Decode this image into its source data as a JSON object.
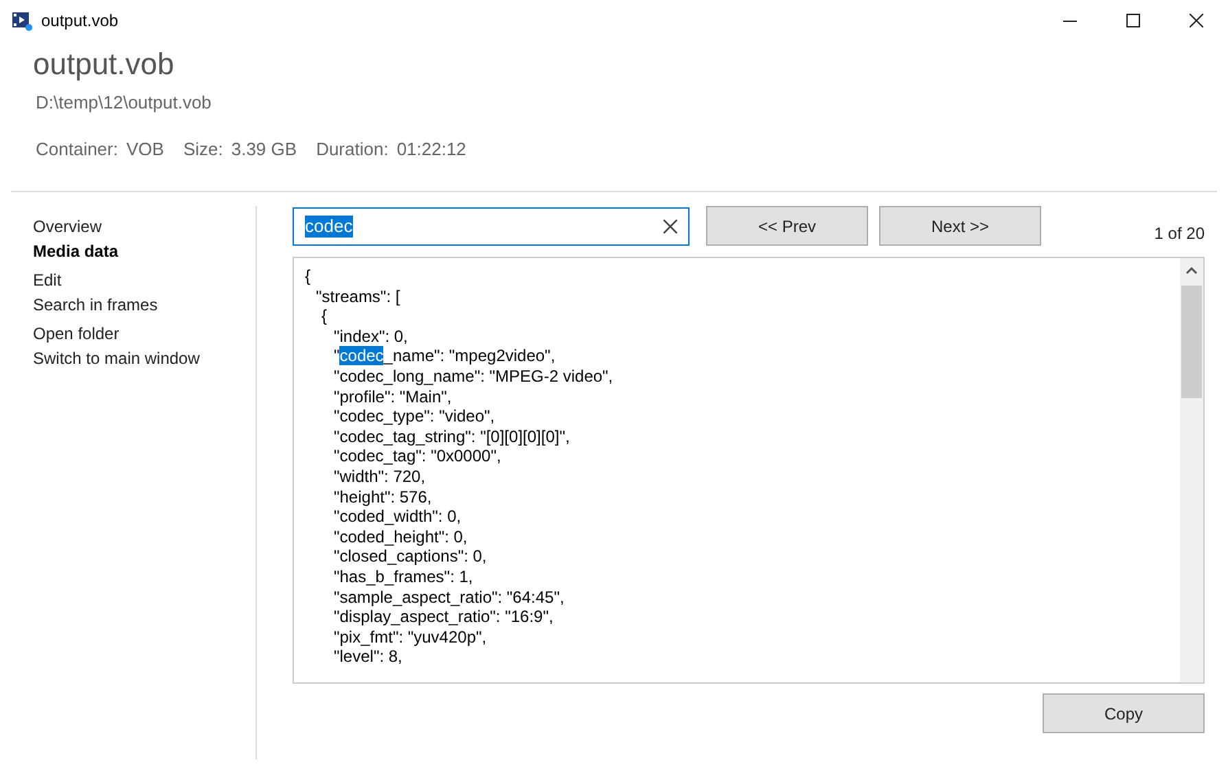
{
  "window": {
    "title": "output.vob"
  },
  "header": {
    "title": "output.vob",
    "path": "D:\\temp\\12\\output.vob",
    "info": [
      {
        "label": "Container:",
        "value": "VOB"
      },
      {
        "label": "Size:",
        "value": "3.39 GB"
      },
      {
        "label": "Duration:",
        "value": "01:22:12"
      }
    ]
  },
  "sidebar": {
    "items": [
      {
        "label": "Overview",
        "selected": false
      },
      {
        "label": "Media data",
        "selected": true
      },
      {
        "label": "Edit",
        "selected": false
      },
      {
        "label": "Search in frames",
        "selected": false
      },
      {
        "label": "Open folder",
        "selected": false
      },
      {
        "label": "Switch to main window",
        "selected": false
      }
    ]
  },
  "search": {
    "value": "codec",
    "prev": "<< Prev",
    "next": "Next >>",
    "count": "1 of 20"
  },
  "lines": [
    {
      "text": "{",
      "children": [
        {
          "text": "\"streams\": [",
          "children": [
            {
              "text": "{",
              "children": [
                {
                  "text": "\"index\": 0,"
                },
                {
                  "text": "\"",
                  "match": "codec",
                  "after": "_name\": \"mpeg2video\","
                },
                {
                  "text": "\"codec_long_name\": \"MPEG-2 video\","
                },
                {
                  "text": "\"profile\": \"Main\","
                },
                {
                  "text": "\"codec_type\": \"video\","
                },
                {
                  "text": "\"codec_tag_string\": \"[0][0][0][0]\","
                },
                {
                  "text": "\"codec_tag\": \"0x0000\","
                },
                {
                  "text": "\"width\": 720,"
                },
                {
                  "text": "\"height\": 576,"
                },
                {
                  "text": "\"coded_width\": 0,"
                },
                {
                  "text": "\"coded_height\": 0,"
                },
                {
                  "text": "\"closed_captions\": 0,"
                },
                {
                  "text": "\"has_b_frames\": 1,"
                },
                {
                  "text": "\"sample_aspect_ratio\": \"64:45\","
                },
                {
                  "text": "\"display_aspect_ratio\": \"16:9\","
                },
                {
                  "text": "\"pix_fmt\": \"yuv420p\","
                },
                {
                  "text": "\"level\": 8,"
                }
              ]
            }
          ]
        }
      ]
    }
  ],
  "copy_button": "Copy"
}
